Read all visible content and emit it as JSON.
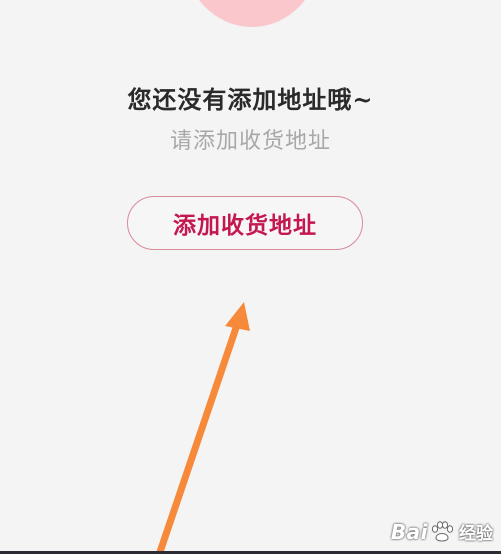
{
  "empty_state": {
    "title": "您还没有添加地址哦~",
    "subtitle": "请添加收货地址",
    "add_button_label": "添加收货地址"
  },
  "watermark": {
    "brand_left": "Bai",
    "brand_right": "",
    "service": "经验"
  },
  "colors": {
    "accent": "#c4174f",
    "button_border": "#d88a98",
    "arrow": "#f6893a",
    "decor_circle": "#f9c7cc"
  }
}
